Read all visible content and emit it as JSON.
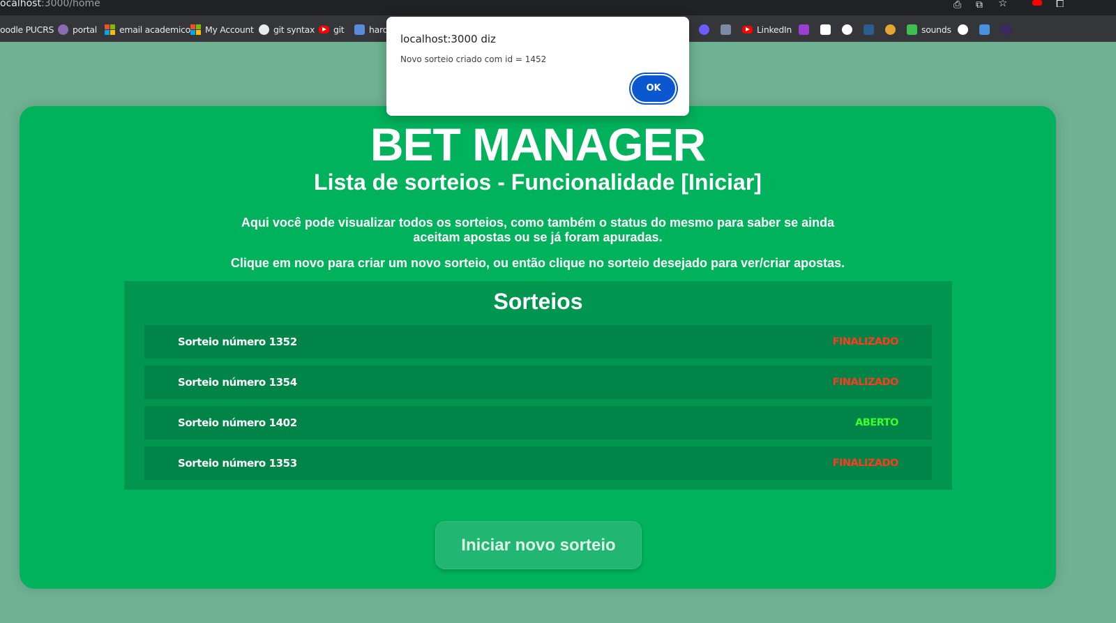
{
  "browser": {
    "url_host": "ocalhost",
    "url_path": ":3000/home",
    "bookmarks": [
      {
        "label": "oodle PUCRS",
        "icon": "none"
      },
      {
        "label": "portal",
        "icon": "portal-icon"
      },
      {
        "label": "email academico",
        "icon": "microsoft-icon"
      },
      {
        "label": "My Account",
        "icon": "microsoft-icon"
      },
      {
        "label": "git syntax",
        "icon": "github-icon"
      },
      {
        "label": "git",
        "icon": "youtube-icon"
      },
      {
        "label": "hard",
        "icon": "bookmark-icon"
      },
      {
        "label": "LinkedIn",
        "icon": "youtube-icon"
      },
      {
        "label": "sounds",
        "icon": "px-icon"
      }
    ]
  },
  "dialog": {
    "title": "localhost:3000 diz",
    "message": "Novo sorteio criado com id = 1452",
    "ok_label": "OK"
  },
  "page": {
    "title": "BET MANAGER",
    "subtitle": "Lista de sorteios - Funcionalidade [Iniciar]",
    "description": "Aqui você pode visualizar todos os sorteios, como também o status do mesmo para saber se ainda aceitam apostas ou se já foram apuradas.",
    "instruction": "Clique em novo para criar um novo sorteio, ou então clique no sorteio desejado para ver/criar apostas.",
    "panel_title": "Sorteios",
    "draws": [
      {
        "name": "Sorteio número 1352",
        "status": "FINALIZADO"
      },
      {
        "name": "Sorteio número 1354",
        "status": "FINALIZADO"
      },
      {
        "name": "Sorteio número 1402",
        "status": "ABERTO"
      },
      {
        "name": "Sorteio número 1353",
        "status": "FINALIZADO"
      }
    ],
    "new_button_label": "Iniciar novo sorteio"
  },
  "colors": {
    "background": "#6fb192",
    "card": "#00b25b",
    "panel": "#00964f",
    "row": "#008447",
    "status_finalizado": "#ff3b1f",
    "status_aberto": "#3cff2e",
    "dialog_ok": "#0b57d0"
  }
}
